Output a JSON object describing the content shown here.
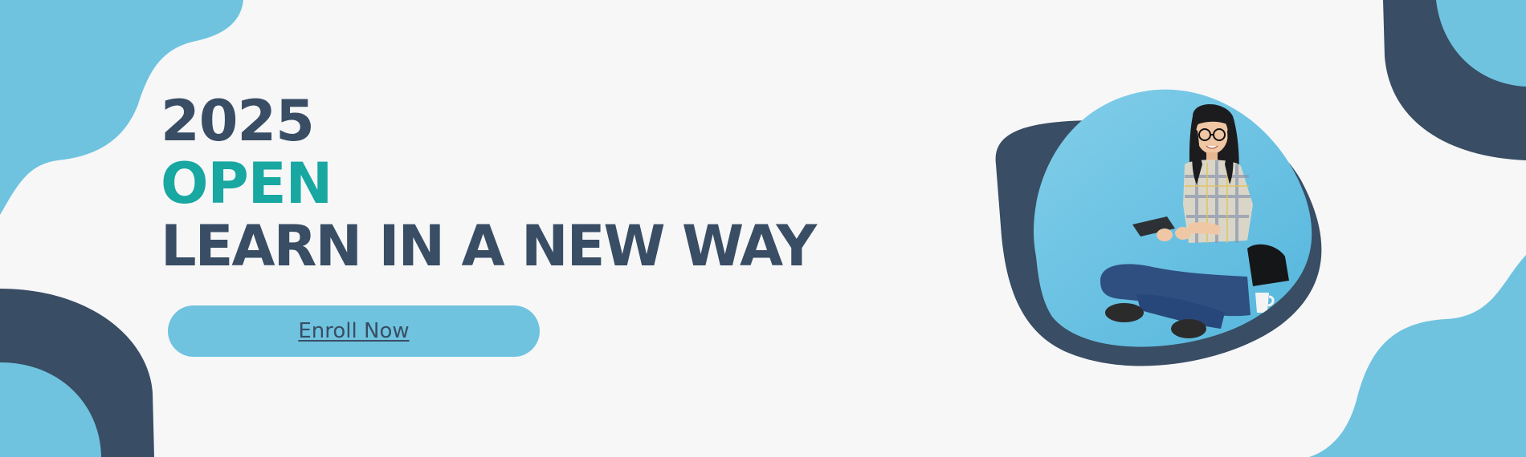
{
  "headline": {
    "year": "2025",
    "highlight": "OPEN",
    "tagline": "LEARN IN A NEW WAY"
  },
  "cta": {
    "label": "Enroll Now"
  },
  "colors": {
    "background": "#f7f7f8",
    "light_blue": "#6fc3df",
    "navy": "#394d64",
    "teal": "#18a7a1"
  },
  "photo": {
    "subject": "student-with-tablet"
  }
}
